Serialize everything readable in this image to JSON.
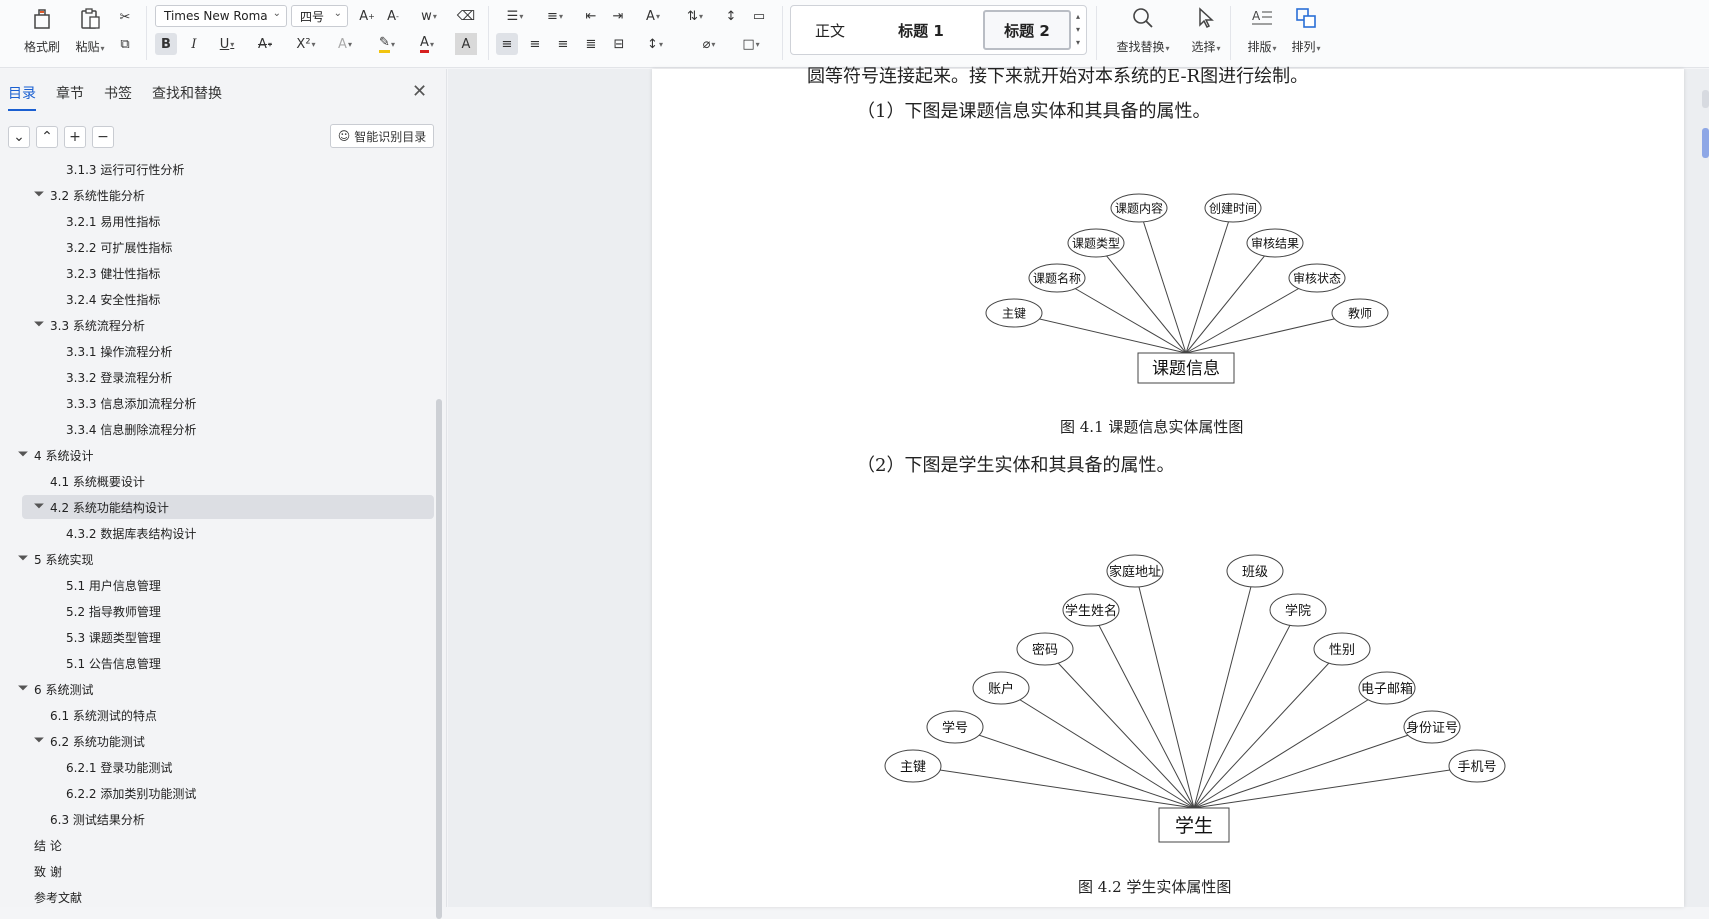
{
  "ribbon": {
    "format_painter": "格式刷",
    "paste": "粘贴",
    "font_name": "Times New Roma",
    "font_size": "四号",
    "styles": [
      "正文",
      "标题 1",
      "标题 2"
    ],
    "find_replace": "查找替换",
    "select": "选择",
    "layout": "排版",
    "arrange": "排列",
    "icons": [
      "clipboard-icon",
      "paste-icon",
      "cut-icon",
      "copy-icon",
      "bold-icon",
      "italic-icon",
      "underline-icon",
      "strikethrough-icon",
      "superscript-icon",
      "font-color-icon",
      "highlight-icon",
      "eraser-icon",
      "bullets-icon",
      "numbering-icon",
      "align-left-icon",
      "center-icon",
      "align-right-icon",
      "justify-icon",
      "search-icon",
      "cursor-icon"
    ]
  },
  "nav": {
    "tabs": [
      "目录",
      "章节",
      "书签",
      "查找和替换"
    ],
    "smart_toc": "智能识别目录",
    "items": [
      {
        "label": "3.1.3  运行可行性分析",
        "level": 3,
        "expand": false
      },
      {
        "label": "3.2  系统性能分析",
        "level": 2,
        "expand": true
      },
      {
        "label": "3.2.1  易用性指标",
        "level": 3,
        "expand": false
      },
      {
        "label": "3.2.2  可扩展性指标",
        "level": 3,
        "expand": false
      },
      {
        "label": "3.2.3  健壮性指标",
        "level": 3,
        "expand": false
      },
      {
        "label": "3.2.4  安全性指标",
        "level": 3,
        "expand": false
      },
      {
        "label": "3.3  系统流程分析",
        "level": 2,
        "expand": true
      },
      {
        "label": "3.3.1  操作流程分析",
        "level": 3,
        "expand": false
      },
      {
        "label": "3.3.2  登录流程分析",
        "level": 3,
        "expand": false
      },
      {
        "label": "3.3.3  信息添加流程分析",
        "level": 3,
        "expand": false
      },
      {
        "label": "3.3.4  信息删除流程分析",
        "level": 3,
        "expand": false
      },
      {
        "label": "4  系统设计",
        "level": 1,
        "expand": true
      },
      {
        "label": "4.1  系统概要设计",
        "level": 2,
        "expand": false
      },
      {
        "label": "4.2  系统功能结构设计",
        "level": 2,
        "expand": true,
        "selected": true
      },
      {
        "label": "4.3.2  数据库表结构设计",
        "level": 3,
        "expand": false
      },
      {
        "label": " 5  系统实现",
        "level": 1,
        "expand": true
      },
      {
        "label": "5.1 用户信息管理",
        "level": 3,
        "expand": false
      },
      {
        "label": "5.2  指导教师管理",
        "level": 3,
        "expand": false
      },
      {
        "label": "5.3 课题类型管理",
        "level": 3,
        "expand": false
      },
      {
        "label": "5.1 公告信息管理",
        "level": 3,
        "expand": false
      },
      {
        "label": "6  系统测试",
        "level": 1,
        "expand": true
      },
      {
        "label": "6.1  系统测试的特点",
        "level": 2,
        "expand": false
      },
      {
        "label": "6.2  系统功能测试",
        "level": 2,
        "expand": true
      },
      {
        "label": "6.2.1  登录功能测试",
        "level": 3,
        "expand": false
      },
      {
        "label": "6.2.2  添加类别功能测试",
        "level": 3,
        "expand": false
      },
      {
        "label": "6.3  测试结果分析",
        "level": 2,
        "expand": false
      },
      {
        "label": "结    论",
        "level": 1,
        "expand": false
      },
      {
        "label": "致    谢",
        "level": 1,
        "expand": false
      },
      {
        "label": "参考文献",
        "level": 1,
        "expand": false
      }
    ]
  },
  "document": {
    "line_top": "圆等符号连接起来。接下来就开始对本系统的E-R图进行绘制。",
    "para1": "（1）下图是课题信息实体和其具备的属性。",
    "para2": "（2）下图是学生实体和其具备的属性。",
    "fig1": {
      "entity": "课题信息",
      "attrs": [
        "主键",
        "课题名称",
        "课题类型",
        "课题内容",
        "创建时间",
        "审核结果",
        "审核状态",
        "教师"
      ],
      "caption": "图 4.1  课题信息实体属性图"
    },
    "fig2": {
      "entity": "学生",
      "attrs": [
        "主键",
        "学号",
        "账户",
        "密码",
        "学生姓名",
        "家庭地址",
        "班级",
        "学院",
        "性别",
        "电子邮箱",
        "身份证号",
        "手机号"
      ],
      "caption": "图 4.2  学生实体属性图"
    }
  }
}
